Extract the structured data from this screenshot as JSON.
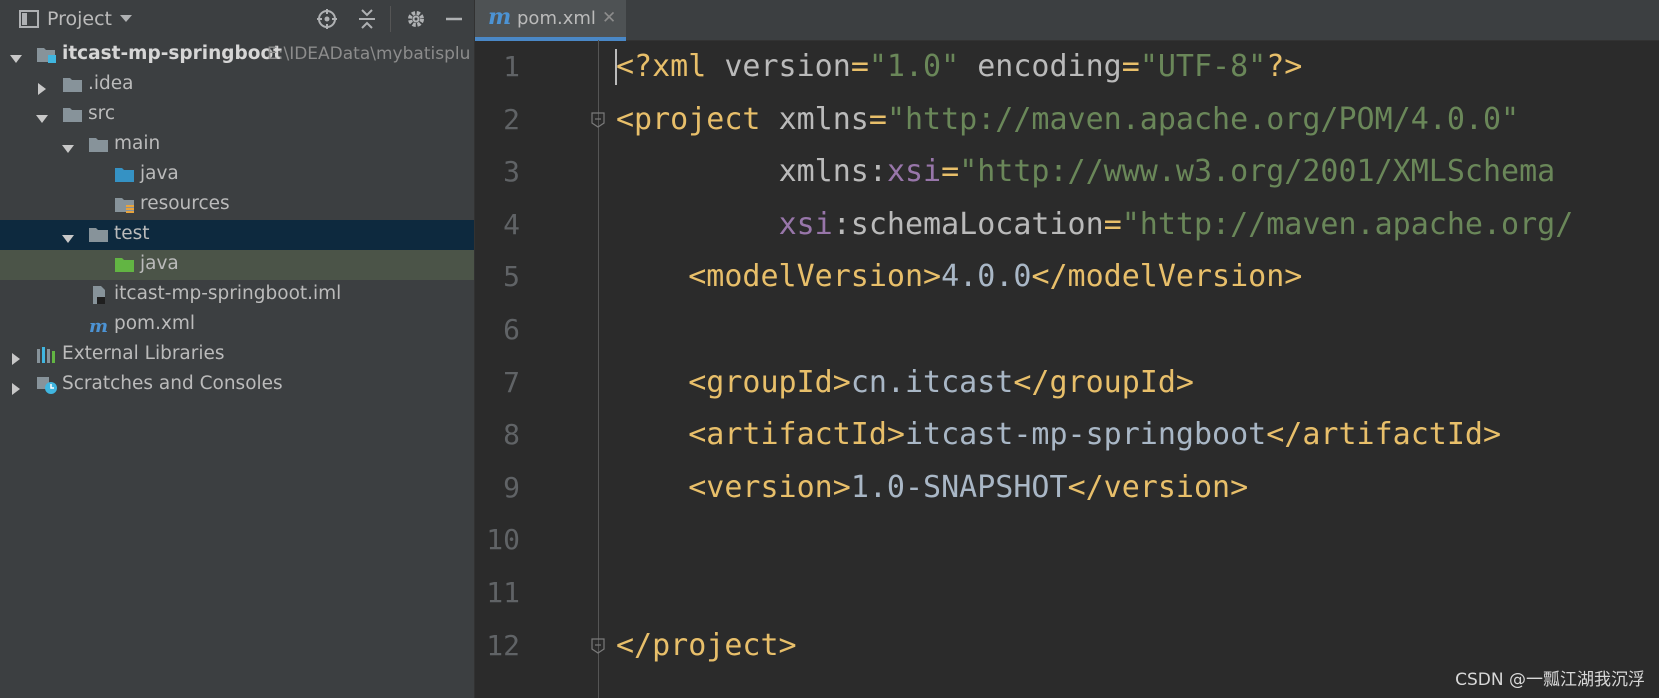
{
  "sidebar": {
    "title": "Project",
    "icons": [
      "locate-icon",
      "collapse-icon",
      "gear-icon",
      "minimize-icon"
    ],
    "tree": [
      {
        "label": "itcast-mp-springboot",
        "path": "E:\\IDEAData\\mybatisplu",
        "depth": 0,
        "expanded": true,
        "icon": "module-folder-icon",
        "bold": true
      },
      {
        "label": ".idea",
        "depth": 1,
        "expanded": false,
        "icon": "folder-icon"
      },
      {
        "label": "src",
        "depth": 1,
        "expanded": true,
        "icon": "folder-icon"
      },
      {
        "label": "main",
        "depth": 2,
        "expanded": true,
        "icon": "folder-icon"
      },
      {
        "label": "java",
        "depth": 3,
        "icon": "source-folder-icon"
      },
      {
        "label": "resources",
        "depth": 3,
        "icon": "resources-folder-icon"
      },
      {
        "label": "test",
        "depth": 2,
        "expanded": true,
        "icon": "folder-icon",
        "state": "selected"
      },
      {
        "label": "java",
        "depth": 3,
        "icon": "test-folder-icon",
        "state": "secondary"
      },
      {
        "label": "itcast-mp-springboot.iml",
        "depth": 2,
        "icon": "iml-file-icon"
      },
      {
        "label": "pom.xml",
        "depth": 2,
        "icon": "maven-file-icon"
      },
      {
        "label": "External Libraries",
        "depth": 0,
        "expanded": false,
        "icon": "libraries-icon"
      },
      {
        "label": "Scratches and Consoles",
        "depth": 0,
        "expanded": false,
        "icon": "scratches-icon"
      }
    ]
  },
  "editor": {
    "tab": {
      "label": "pom.xml",
      "icon_letter": "m",
      "close": "✕"
    },
    "lines": [
      {
        "n": "1",
        "tokens": [
          [
            "tag",
            "<?"
          ],
          [
            "tag",
            "xml "
          ],
          [
            "attr",
            "version"
          ],
          [
            "tag",
            "="
          ],
          [
            "val",
            "\"1.0\""
          ],
          [
            "tag",
            " "
          ],
          [
            "attr",
            "encoding"
          ],
          [
            "tag",
            "="
          ],
          [
            "val",
            "\"UTF-8\""
          ],
          [
            "tag",
            "?>"
          ]
        ]
      },
      {
        "n": "2",
        "fold": true,
        "tokens": [
          [
            "tag",
            "<project "
          ],
          [
            "attr",
            "xmlns"
          ],
          [
            "tag",
            "="
          ],
          [
            "val",
            "\"http://maven.apache.org/POM/4.0.0\""
          ]
        ]
      },
      {
        "n": "3",
        "tokens": [
          [
            "text",
            "         "
          ],
          [
            "attr",
            "xmlns:"
          ],
          [
            "ns",
            "xsi"
          ],
          [
            "tag",
            "="
          ],
          [
            "val",
            "\"http://www.w3.org/2001/XMLSchema"
          ]
        ]
      },
      {
        "n": "4",
        "tokens": [
          [
            "text",
            "         "
          ],
          [
            "ns",
            "xsi"
          ],
          [
            "attr",
            ":schemaLocation"
          ],
          [
            "tag",
            "="
          ],
          [
            "val",
            "\"http://maven.apache.org/"
          ]
        ]
      },
      {
        "n": "5",
        "tokens": [
          [
            "text",
            "    "
          ],
          [
            "tag",
            "<modelVersion>"
          ],
          [
            "text",
            "4.0.0"
          ],
          [
            "tag",
            "</modelVersion>"
          ]
        ]
      },
      {
        "n": "6",
        "tokens": []
      },
      {
        "n": "7",
        "tokens": [
          [
            "text",
            "    "
          ],
          [
            "tag",
            "<groupId>"
          ],
          [
            "text",
            "cn.itcast"
          ],
          [
            "tag",
            "</groupId>"
          ]
        ]
      },
      {
        "n": "8",
        "tokens": [
          [
            "text",
            "    "
          ],
          [
            "tag",
            "<artifactId>"
          ],
          [
            "text",
            "itcast-mp-springboot"
          ],
          [
            "tag",
            "</artifactId>"
          ]
        ]
      },
      {
        "n": "9",
        "tokens": [
          [
            "text",
            "    "
          ],
          [
            "tag",
            "<version>"
          ],
          [
            "text",
            "1.0-SNAPSHOT"
          ],
          [
            "tag",
            "</version>"
          ]
        ]
      },
      {
        "n": "10",
        "tokens": []
      },
      {
        "n": "11",
        "tokens": []
      },
      {
        "n": "12",
        "fold": true,
        "tokens": [
          [
            "tag",
            "</project>"
          ]
        ]
      }
    ]
  },
  "watermark": "CSDN @一瓢江湖我沉浮",
  "colors": {
    "tag": "#e8bf6a",
    "attr": "#bababa",
    "value": "#6a8759",
    "namespace": "#9876aa",
    "text": "#a9b7c6",
    "selection": "#0d293e"
  }
}
